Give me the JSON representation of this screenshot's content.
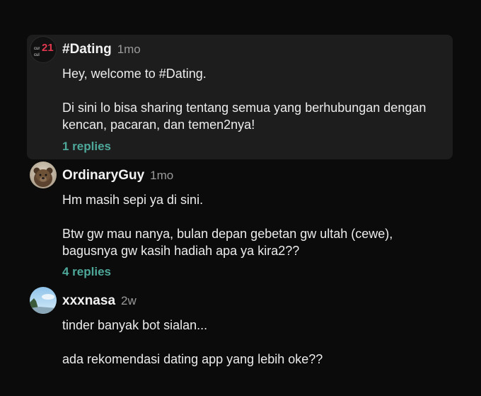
{
  "posts": [
    {
      "author": "#Dating",
      "time": "1mo",
      "avatar": {
        "icon": "channel-logo-avatar",
        "logo_text": "21",
        "logo_sub": [
          "cur",
          "cul"
        ]
      },
      "paragraphs": [
        "Hey, welcome to #Dating.",
        "Di sini lo bisa sharing tentang semua yang berhubungan dengan kencan, pacaran, dan temen2nya!"
      ],
      "replies": "1 replies"
    },
    {
      "author": "OrdinaryGuy",
      "time": "1mo",
      "avatar": {
        "icon": "bear-photo-avatar"
      },
      "paragraphs": [
        "Hm masih sepi ya di sini.",
        "Btw gw mau nanya, bulan depan gebetan gw ultah (cewe), bagusnya gw kasih hadiah apa ya kira2??"
      ],
      "replies": "4 replies"
    },
    {
      "author": "xxxnasa",
      "time": "2w",
      "avatar": {
        "icon": "sky-photo-avatar"
      },
      "paragraphs": [
        "tinder banyak bot sialan...",
        "ada rekomendasi dating app yang lebih oke??"
      ]
    }
  ],
  "colors": {
    "background": "#0b0b0b",
    "highlight_card": "#1d1d1d",
    "replies_link": "#4ea89a",
    "timestamp": "#9a9a9a",
    "logo_accent": "#e2374f"
  }
}
